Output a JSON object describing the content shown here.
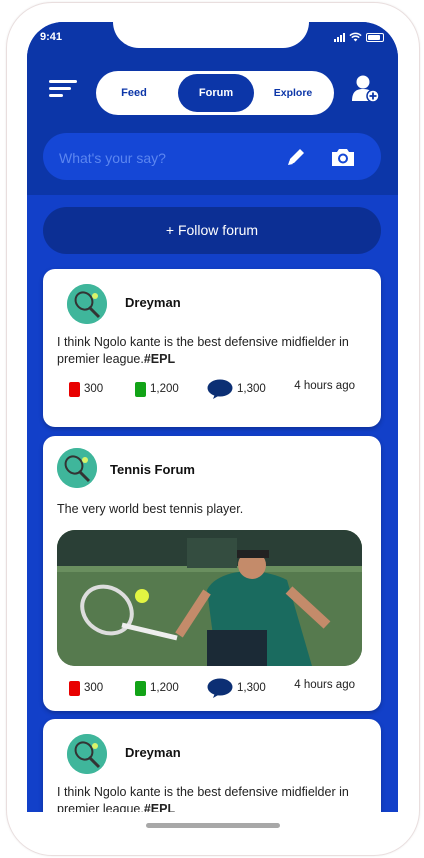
{
  "status_bar": {
    "time": "9:41"
  },
  "nav": {
    "tabs": [
      "Feed",
      "Forum",
      "Explore"
    ],
    "active_tab": "Forum"
  },
  "search": {
    "placeholder": "What's your say?"
  },
  "follow_button": {
    "label": "+ Follow forum"
  },
  "posts": [
    {
      "author": "Dreyman",
      "text": "I think Ngolo kante is the best defensive midfielder in premier league.",
      "hashtag": "#EPL",
      "red_count": "300",
      "green_count": "1,200",
      "comments": "1,300",
      "time": "4 hours ago"
    },
    {
      "author": "Tennis Forum",
      "text": "The very world best tennis player.",
      "red_count": "300",
      "green_count": "1,200",
      "comments": "1,300",
      "time": "4 hours ago",
      "image": "tennis-player-photo"
    },
    {
      "author": "Dreyman",
      "text": "I think Ngolo kante is the best defensive midfielder in premier league.",
      "hashtag": "#EPL"
    }
  ],
  "colors": {
    "primary": "#0c36a8",
    "background": "#1240c9",
    "red": "#e80000",
    "green": "#12a317"
  }
}
